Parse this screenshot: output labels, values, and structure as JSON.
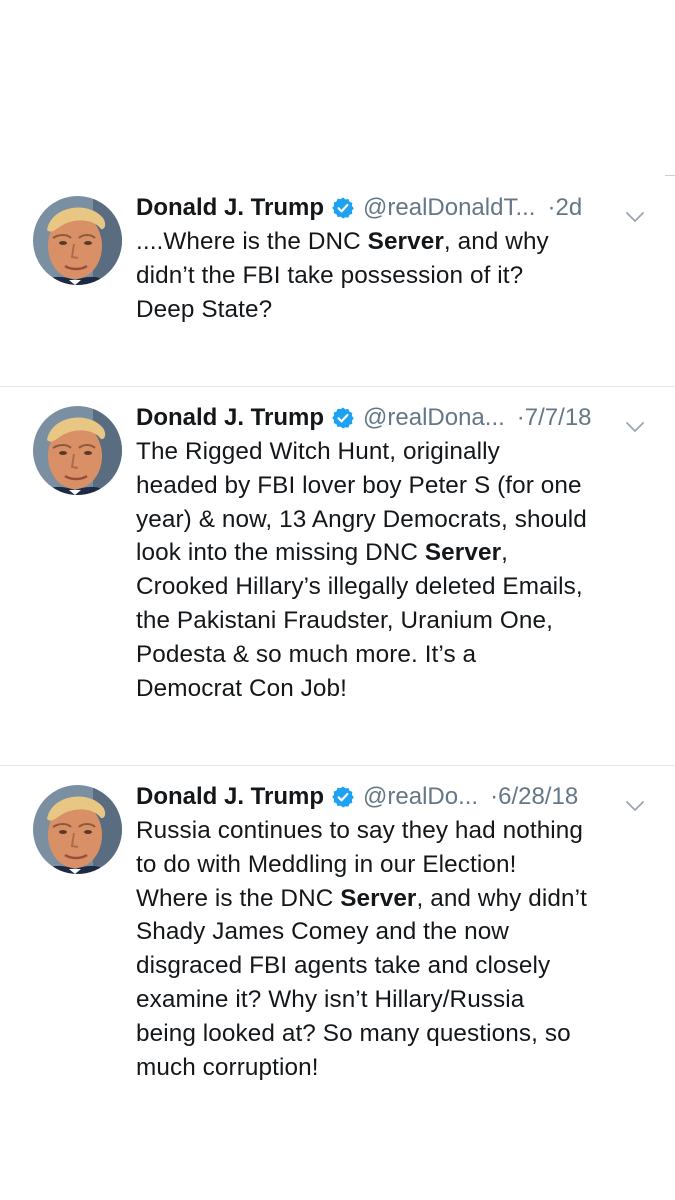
{
  "tweets": [
    {
      "name": "Donald J. Trump",
      "handle": "@realDonaldT...",
      "time": "2d",
      "lines": [
        [
          "....Where is the DNC ",
          "Server",
          ", and why"
        ],
        [
          "didn’t the FBI take possession of it?",
          "",
          ""
        ],
        [
          "Deep State?",
          "",
          ""
        ]
      ]
    },
    {
      "name": "Donald J. Trump",
      "handle": "@realDona...",
      "time": "7/7/18",
      "lines": [
        [
          "The Rigged Witch Hunt, originally",
          "",
          ""
        ],
        [
          "headed by FBI lover boy Peter S (for one",
          "",
          ""
        ],
        [
          "year) & now, 13 Angry Democrats, should",
          "",
          ""
        ],
        [
          "look into the missing DNC ",
          "Server",
          ","
        ],
        [
          "Crooked Hillary’s illegally deleted Emails,",
          "",
          ""
        ],
        [
          "the Pakistani Fraudster, Uranium One,",
          "",
          ""
        ],
        [
          "Podesta & so much more. It’s a",
          "",
          ""
        ],
        [
          "Democrat Con Job!",
          "",
          ""
        ]
      ]
    },
    {
      "name": "Donald J. Trump",
      "handle": "@realDo...",
      "time": "6/28/18",
      "lines": [
        [
          "Russia continues to say they had nothing",
          "",
          ""
        ],
        [
          "to do with Meddling in our Election!",
          "",
          ""
        ],
        [
          "Where is the DNC ",
          "Server",
          ", and why didn’t"
        ],
        [
          "Shady James Comey and the now",
          "",
          ""
        ],
        [
          "disgraced FBI agents take and closely",
          "",
          ""
        ],
        [
          "examine it? Why isn’t Hillary/Russia",
          "",
          ""
        ],
        [
          "being looked at? So many questions, so",
          "",
          ""
        ],
        [
          "much corruption!",
          "",
          ""
        ]
      ]
    }
  ],
  "icons": {
    "verified": "verified-badge-icon",
    "menu": "chevron-down-icon"
  },
  "colors": {
    "verified": "#1da1f2",
    "secondary_text": "#657786",
    "divider": "#e1e8ed"
  }
}
